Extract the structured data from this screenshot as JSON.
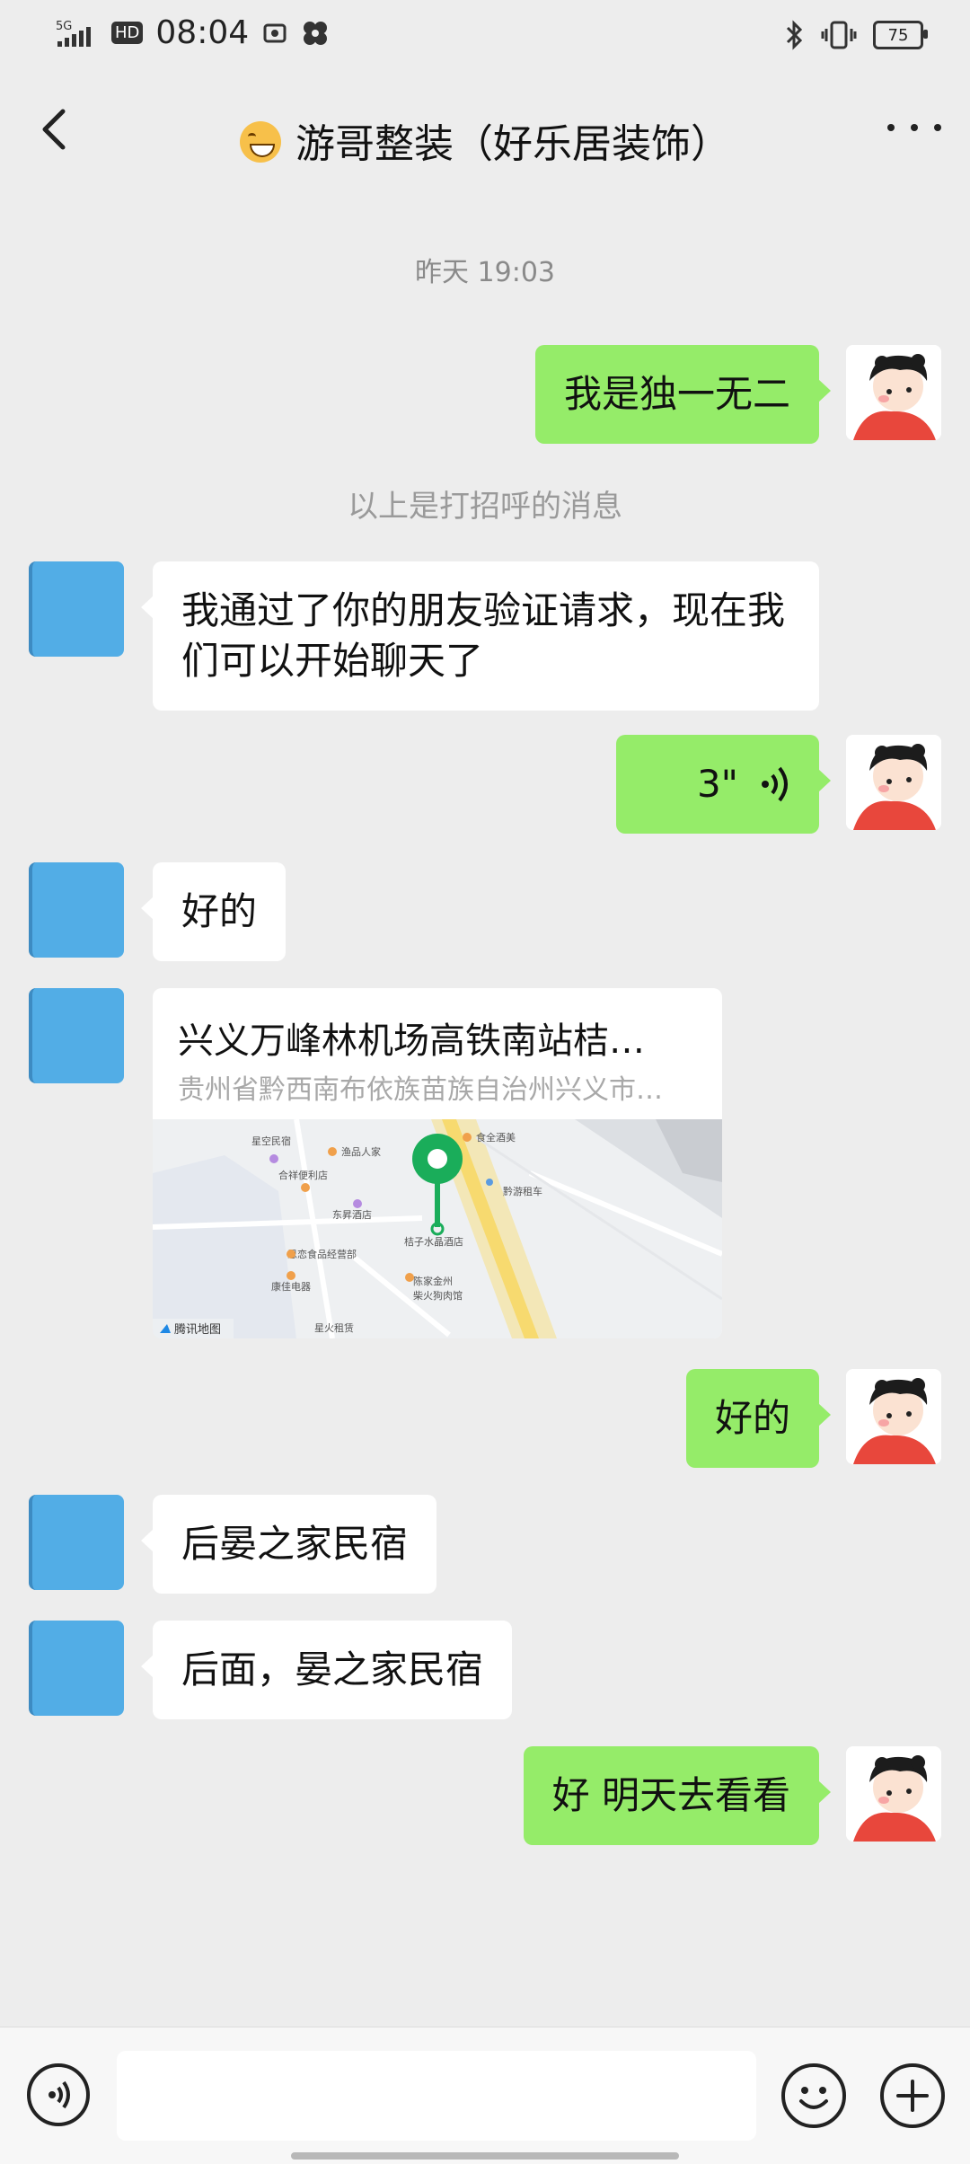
{
  "status_bar": {
    "time": "08:04",
    "network": "5G",
    "hd": "HD",
    "battery": "75"
  },
  "header": {
    "title": "游哥整装（好乐居装饰）",
    "title_emoji": "grinning-face-emoji"
  },
  "chat": {
    "timestamp": "昨天 19:03",
    "system_message": "以上是打招呼的消息",
    "messages": [
      {
        "from": "me",
        "type": "text",
        "text": "我是独一无二"
      },
      {
        "from": "them",
        "type": "text",
        "text": "我通过了你的朋友验证请求，现在我们可以开始聊天了"
      },
      {
        "from": "me",
        "type": "voice",
        "duration": "3\""
      },
      {
        "from": "them",
        "type": "text",
        "text": "好的"
      },
      {
        "from": "them",
        "type": "location",
        "title": "兴义万峰林机场高铁南站桔…",
        "address": "贵州省黔西南布依族苗族自治州兴义市…"
      },
      {
        "from": "me",
        "type": "text",
        "text": "好的"
      },
      {
        "from": "them",
        "type": "text",
        "text": "后晏之家民宿"
      },
      {
        "from": "them",
        "type": "text",
        "text": "后面，晏之家民宿"
      },
      {
        "from": "me",
        "type": "text",
        "text": "好 明天去看看"
      }
    ]
  },
  "map_labels": {
    "l1": "星空民宿",
    "l2": "渔品人家",
    "l3": "食全酒美",
    "l4": "合祥便利店",
    "l5": "黔游租车",
    "l6": "东昇酒店",
    "l7": "桔子水晶酒店",
    "l8": "思恋食品经营部",
    "l9": "陈家金州",
    "l10": "柴火狗肉馆",
    "l11": "康佳电器",
    "l12": "星火租赁",
    "brand": "腾讯地图"
  },
  "colors": {
    "background": "#ededed",
    "outgoing_bubble": "#95ec69",
    "incoming_bubble": "#ffffff",
    "avatar_placeholder": "#52ade6",
    "pin": "#1aad5a"
  }
}
